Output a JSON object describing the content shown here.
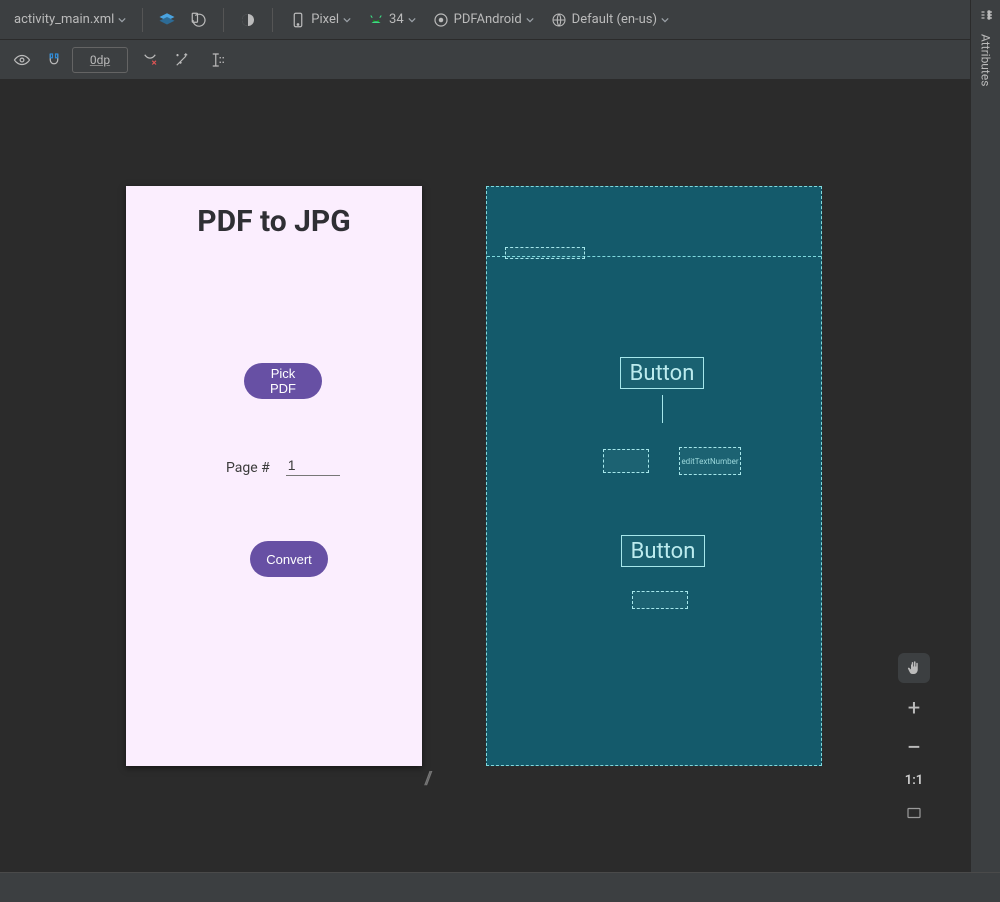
{
  "toolbar": {
    "file_tab": "activity_main.xml",
    "device": "Pixel",
    "api": "34",
    "theme": "PDFAndroid",
    "locale": "Default (en-us)"
  },
  "toolbar2": {
    "margin_value": "0dp"
  },
  "right_rail": {
    "attributes_label": "Attributes"
  },
  "zoom": {
    "one_to_one": "1:1"
  },
  "design": {
    "title": "PDF to JPG",
    "pick_label": "Pick PDF",
    "page_label": "Page #",
    "page_value": "1",
    "convert_label": "Convert"
  },
  "blueprint": {
    "button_label": "Button",
    "edit_hint": "editTextNumber"
  }
}
